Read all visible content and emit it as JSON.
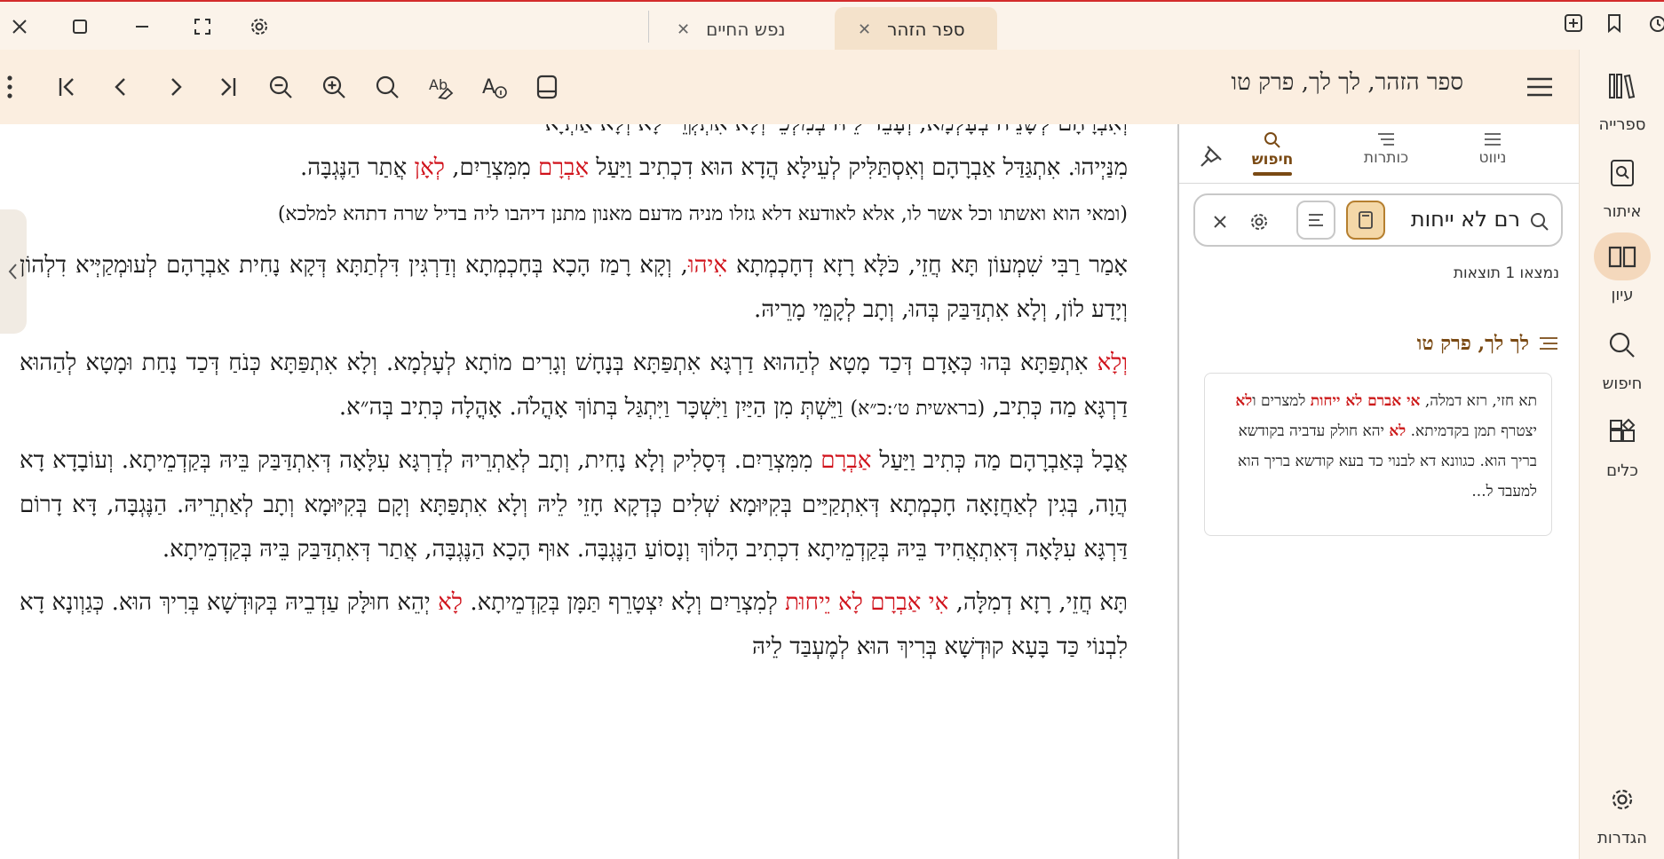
{
  "tabs": [
    {
      "label": "ספר הזהר",
      "active": true
    },
    {
      "label": "נפש החיים",
      "active": false
    }
  ],
  "toolbar": {
    "title": "ספר הזהר, לך לך, פרק טו"
  },
  "rail": {
    "items": [
      {
        "label": "ספרייה",
        "icon": "library-icon"
      },
      {
        "label": "איתור",
        "icon": "locate-icon"
      },
      {
        "label": "עיון",
        "icon": "book-open-icon",
        "active": true
      },
      {
        "label": "חיפוש",
        "icon": "search-icon"
      },
      {
        "label": "כלים",
        "icon": "tools-icon"
      },
      {
        "label": "הגדרות",
        "icon": "gear-icon"
      }
    ]
  },
  "panel": {
    "tabs": [
      {
        "label": "ניווט"
      },
      {
        "label": "כותרות"
      },
      {
        "label": "חיפוש",
        "active": true
      }
    ],
    "search_value": "רם לא ייחות",
    "result_count": "נמצאו 1 תוצאות",
    "result_header": "לך לך, פרק טו",
    "result_snippet": {
      "p1": "תא חזי, רזא דמלה, ",
      "h1": "אי אברם לא ייחות",
      "p2": " למצרים ו",
      "h2": "לא",
      "p3": " יצטרף תמן בקדמיתא. ",
      "h3": "לא",
      "p4": " יהא חולק עדביה בקודשא בריך הוא. כגוונא דא לבנוי כד בעא קודשא בריך הוא למעבד ל..."
    }
  },
  "main": {
    "line0": "וְאִבְרָהָם לְשָׁנֵיה בְּעָלְמָא, וְעָבֵד לֵיהּ בְּמִלְּכֵי וְלָא אִתְקְרֵי לָא וְלָא אַתְיָא",
    "p1a": "מִנַּיְיהוּ. אִתְגַּדַּל אַבְרָהָם וְאִסְתַּלִּיק לְעֵילָּא הֲדָא הוּא דִכְתִיב וַיַּעַל ",
    "p1b": "אַבְרָם",
    "p1c": " מִמִּצְרַיִם, ",
    "p1d": "לְאָן",
    "p1e": " אֲתַר הַנֶּגְבָּה.",
    "note": "(ומאי הוא ואשתו וכל אשר לו, אלא לאודעא דלא גזלו מניה מדעם מאנון מתנן דיהבו ליה בדיל שרה דתהא למלכא)",
    "p2a": "אָמַר רַבִּי שִׁמְעוֹן תָּא חֲזֵי, כֹּלָּא רָזָא דְחָכְמְתָא ",
    "p2b": "אִיהוּ",
    "p2c": ", וְקָא רָמַז הָכָא בְּחָכְמְתָא וְדַרְגִּין דִּלְתַתָּא דְּקָא נָחִית אַבְרָהָם לְעוּמְקַיְּיא דִלְהוֹן וְיָדַע לוֹן, וְלָא אִתְדַּבַּק בְּהוּ, וְתָב לְקָמֵּי מָרֵיהּ.",
    "p3a": "וְלָא",
    "p3b": " אִתְפַּתָּא בְּהוּ כְּאָדָם דְּכַד מָטָא לְהַהוּא דַרְגָּא אִתְפַּתָּא בְּנָחָשׁ וְגָרִים מוֹתָא לְעָלְמָא. וְלָא אִתְפַּתָּא כְּנֹחַ דְּכַד נָחַת וּמָטָא לְהַהוּא דַרְגָּא מַה כְּתִיב, ",
    "p3c": "(בראשית ט׳:כ״א)",
    "p3d": " וַיֵּשְׁתְּ מִן הַיַּיִן וַיִּשְׁכָּר וַיִּתְגַּל בְּתוֹךְ אָהֳלֹה. אָהֳלָה כְּתִיב בְּה״א.",
    "p4a": "אֲבָל בְּאַבְרָהָם מַה כְּתִיב וַיַּעַל ",
    "p4b": "אַבְרָם",
    "p4c": " מִמִּצְרַיִם. דְּסָלִיק וְלָא נָחִית, וְתָב לְאַתְרֵיהּ לְדַרְגָּא עִלָּאָה דְּאִתְדַּבַּק בֵּיהּ בְּקַדְמֵיתָא. וְעוֹבָדָא דָא הֲוָה, בְּגִין לְאַחֲזָאָה חָכְמְתָא דְּאִתְקַיַּים בְּקִיּוּמָא שְׁלִים כְּדְקָא חָזֵי לֵיהּ וְלָא אִתְפַּתָּא וְקָם בְּקִיּוּמָא וְתָב לְאַתְרֵיהּ. הַנֶּגְבָּה, דָּא דָרוֹם דַּרְגָּא עִלָּאָה דְּאִתְאֲחִיד בֵּיהּ בְּקַדְמֵיתָא דִכְתִיב הָלוֹךְ וְנָסוֹעַ הַנֶּגְבָּה. אוּף הָכָא הַנֶּגְבָּה, אֲתַר דְּאִתְדַּבַּק בֵּיהּ בְּקַדְמֵיתָא.",
    "p5a": "תָּא חֲזֵי, רָזָא דְמִלָּה, ",
    "p5b": "אִי אַבְרָם לָא יֵיחוּת",
    "p5c": " לְמִצְרַיִם וְלָא יִצְטָרֵף תַּמָּן בְּקַדְמֵיתָא. ",
    "p5d": "לָא",
    "p5e": " יְהֵא חוּלָּק עַדְבֵיהּ בְּקוּדְשָׁא בְּרִיךְ הוּא. כְּגַוְונָא דָא לִבְנוֹי כַּד בָּעָא קוּדְשָׁא בְּרִיךְ הוּא לְמֶעְבַּד לֵיהּ"
  }
}
